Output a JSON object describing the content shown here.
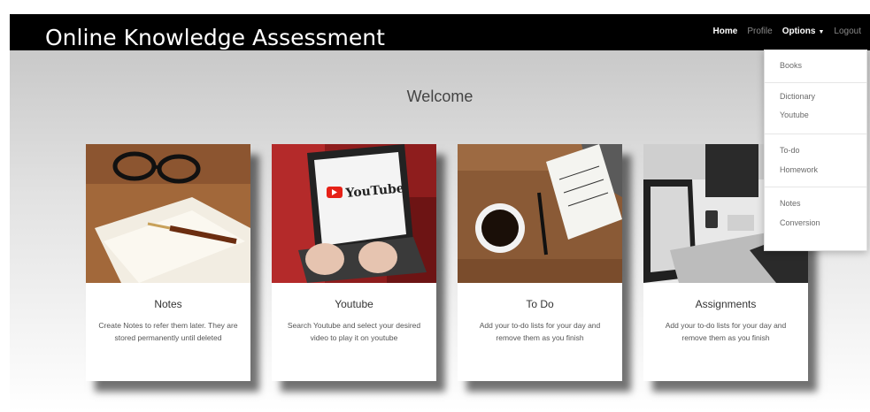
{
  "navbar": {
    "brand": "Online Knowledge Assessment",
    "links": {
      "home": "Home",
      "profile": "Profile",
      "options": "Options",
      "logout": "Logout"
    }
  },
  "page": {
    "heading": "Welcome"
  },
  "cards": [
    {
      "title": "Notes",
      "text": "Create Notes to refer them later. They are stored permanently until deleted"
    },
    {
      "title": "Youtube",
      "text": "Search Youtube and select your desired video to play it on youtube"
    },
    {
      "title": "To Do",
      "text": "Add your to-do lists for your day and remove them as you finish"
    },
    {
      "title": "Assignments",
      "text": "Add your to-do lists for your day and remove them as you finish"
    }
  ],
  "youtube_logo_text": "YouTube",
  "dropdown": {
    "items": [
      "Books",
      "Dictionary",
      "Youtube",
      "To-do",
      "Homework",
      "Notes",
      "Conversion"
    ]
  },
  "colors": {
    "navbar": "#000000",
    "youtube_red": "#e62117"
  }
}
